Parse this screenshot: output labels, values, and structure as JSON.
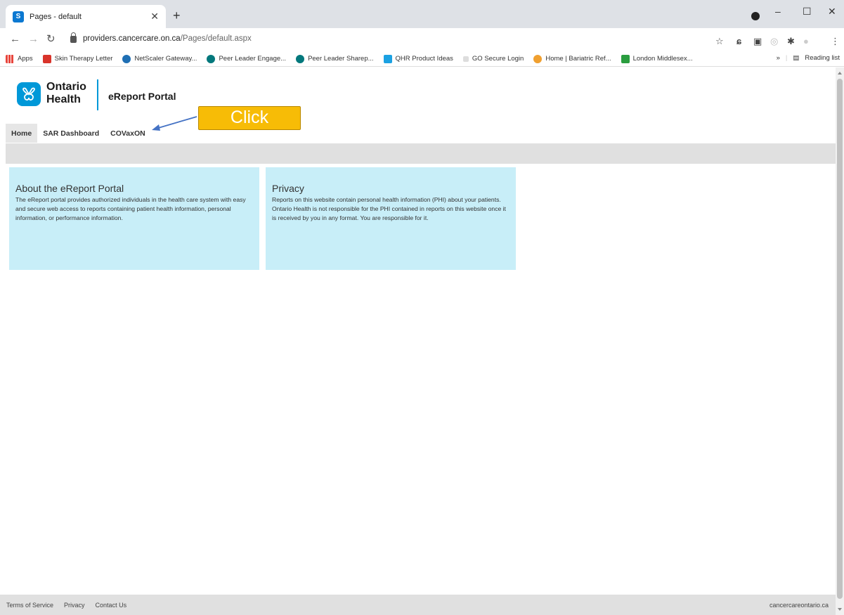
{
  "browser": {
    "tab_title": "Pages - default",
    "tab_favicon": "S",
    "url_host": "providers.cancercare.on.ca",
    "url_path": "/Pages/default.aspx",
    "bookmarks": [
      {
        "label": "Apps",
        "icon": "apps-grid-icon",
        "color": "#e8453c"
      },
      {
        "label": "Skin Therapy Letter",
        "icon": "skin-therapy-icon",
        "color": "#d9342b"
      },
      {
        "label": "NetScaler Gateway...",
        "icon": "netscaler-icon",
        "color": "#1f6fb4"
      },
      {
        "label": "Peer Leader Engage...",
        "icon": "sharepoint-icon",
        "color": "#03787c"
      },
      {
        "label": "Peer Leader Sharep...",
        "icon": "sharepoint-icon",
        "color": "#03787c"
      },
      {
        "label": "QHR Product Ideas",
        "icon": "qhr-icon",
        "color": "#1ba1e2"
      },
      {
        "label": "GO Secure Login",
        "icon": "go-secure-icon",
        "color": "#999999"
      },
      {
        "label": "Home | Bariatric Ref...",
        "icon": "bariatric-icon",
        "color": "#f0a030"
      },
      {
        "label": "London Middlesex...",
        "icon": "london-middlesex-icon",
        "color": "#2a9d3f"
      }
    ],
    "reading_list": "Reading list",
    "more_bookmarks": "»"
  },
  "header": {
    "logo_line1": "Ontario",
    "logo_line2": "Health",
    "portal_title": "eReport Portal"
  },
  "nav": {
    "items": [
      {
        "label": "Home"
      },
      {
        "label": "SAR Dashboard"
      },
      {
        "label": "COVaxON"
      }
    ]
  },
  "annotation": {
    "callout_label": "Click"
  },
  "cards": [
    {
      "title": "About the eReport Portal",
      "body": "The eReport portal provides authorized individuals in the health care system with easy and secure web access to reports containing patient health information, personal information, or performance information."
    },
    {
      "title": "Privacy",
      "body": "Reports on this website contain personal health information (PHI) about your patients. Ontario Health is not responsible for the PHI contained in reports on this website once it is received by you in any format. You are responsible for it."
    }
  ],
  "footer": {
    "links": [
      "Terms of Service",
      "Privacy",
      "Contact Us"
    ],
    "site": "cancercareontario.ca"
  },
  "colors": {
    "brand_blue": "#0098d8",
    "card_bg": "#c8eef8",
    "callout": "#f7bc06",
    "arrow": "#4472c4"
  }
}
